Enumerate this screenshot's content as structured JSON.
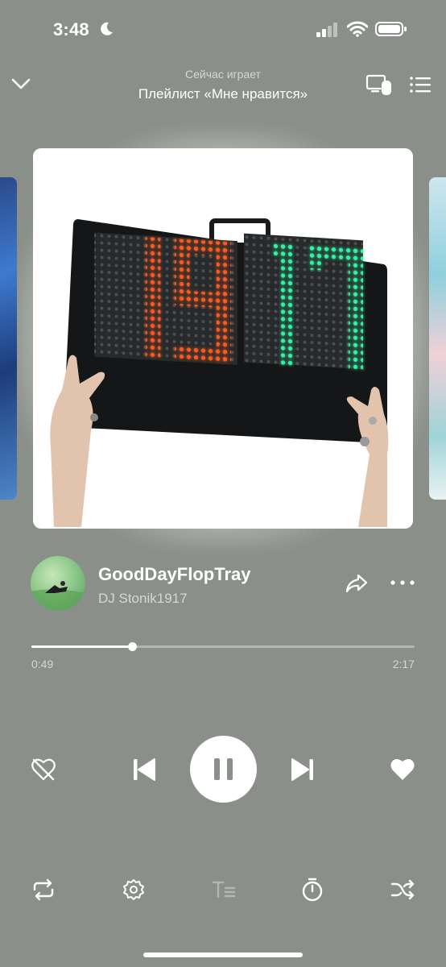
{
  "status_bar": {
    "time": "3:48"
  },
  "header": {
    "subtitle": "Сейчас играет",
    "title": "Плейлист «Мне нравится»"
  },
  "artwork": {
    "scoreboard_left_digits": "19",
    "scoreboard_right_digits": "17"
  },
  "track": {
    "title": "GoodDayFlopTray",
    "artist": "DJ Stonik1917"
  },
  "progress": {
    "elapsed": "0:49",
    "total": "2:17",
    "fraction": 0.2628
  },
  "icons": {
    "header": [
      "chevron-down-icon",
      "device-icon",
      "queue-icon"
    ],
    "track": [
      "share-icon",
      "more-icon"
    ],
    "controls": [
      "dislike-icon",
      "previous-icon",
      "pause-icon",
      "next-icon",
      "heart-icon"
    ],
    "toolbar": [
      "repeat-icon",
      "settings-icon",
      "lyrics-icon",
      "timer-icon",
      "shuffle-icon"
    ]
  },
  "colors": {
    "background": "#8a8f89",
    "led_red": "#ff5a1f",
    "led_green": "#2ef5a0"
  }
}
